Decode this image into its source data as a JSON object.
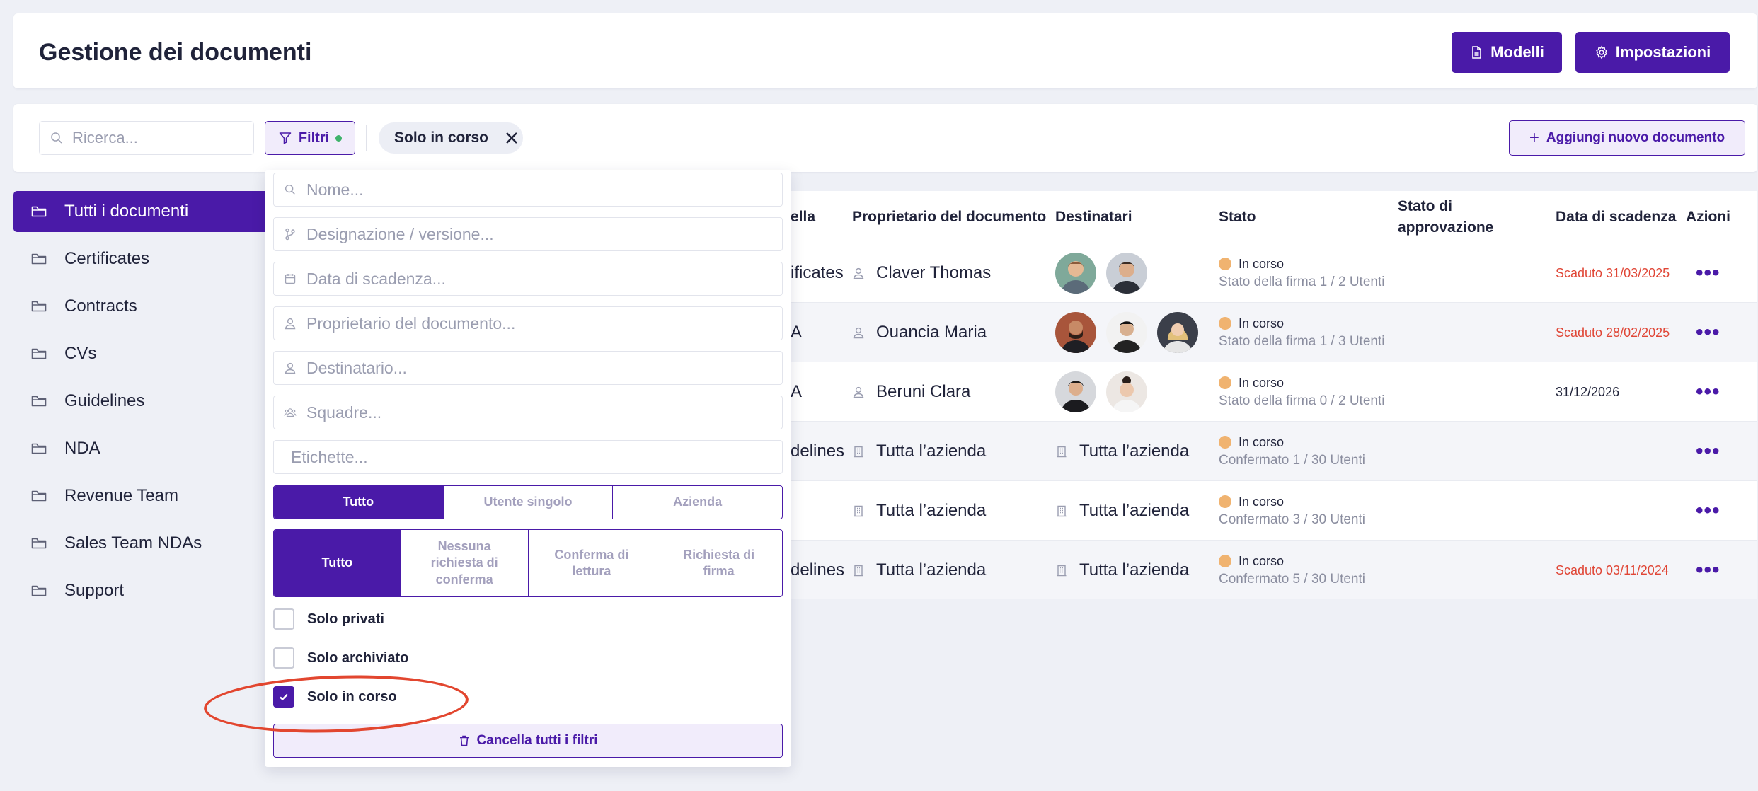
{
  "header": {
    "title": "Gestione dei documenti",
    "templates_label": "Modelli",
    "settings_label": "Impostazioni"
  },
  "toolbar": {
    "search_placeholder": "Ricerca...",
    "filter_label": "Filtri",
    "active_chip": "Solo in corso",
    "add_label": "Aggiungi nuovo documento"
  },
  "sidebar": {
    "items": [
      {
        "label": "Tutti i documenti",
        "active": true
      },
      {
        "label": "Certificates"
      },
      {
        "label": "Contracts"
      },
      {
        "label": "CVs"
      },
      {
        "label": "Guidelines"
      },
      {
        "label": "NDA"
      },
      {
        "label": "Revenue Team"
      },
      {
        "label": "Sales Team NDAs"
      },
      {
        "label": "Support"
      }
    ]
  },
  "table": {
    "columns": {
      "folder_partial": "ella",
      "owner": "Proprietario del documento",
      "recipients": "Destinatari",
      "status": "Stato",
      "approval_1": "Stato di",
      "approval_2": "approvazione",
      "due": "Data di scadenza",
      "actions": "Azioni"
    },
    "rows": [
      {
        "folder": "ificates",
        "owner": "Claver Thomas",
        "recipients_text": "",
        "status": "In corso",
        "status_sub": "Stato della firma 1 / 2 Utenti",
        "due": "Scaduto 31/03/2025",
        "due_red": true,
        "more": "•••"
      },
      {
        "folder": "A",
        "owner": "Ouancia Maria",
        "recipients_text": "",
        "status": "In corso",
        "status_sub": "Stato della firma 1 / 3 Utenti",
        "due": "Scaduto 28/02/2025",
        "due_red": true,
        "more": "•••"
      },
      {
        "folder": "A",
        "owner": "Beruni Clara",
        "recipients_text": "",
        "status": "In corso",
        "status_sub": "Stato della firma 0 / 2 Utenti",
        "due": "31/12/2026",
        "due_red": false,
        "more": "•••"
      },
      {
        "folder": "delines",
        "owner": "Tutta l’azienda",
        "recipients_text": "Tutta l’azienda",
        "status": "In corso",
        "status_sub": "Confermato 1 / 30 Utenti",
        "due": "",
        "due_red": false,
        "more": "•••"
      },
      {
        "folder": "",
        "owner": "Tutta l’azienda",
        "recipients_text": "Tutta l’azienda",
        "status": "In corso",
        "status_sub": "Confermato 3 / 30 Utenti",
        "due": "",
        "due_red": false,
        "more": "•••"
      },
      {
        "folder": "delines",
        "owner": "Tutta l’azienda",
        "recipients_text": "Tutta l’azienda",
        "status": "In corso",
        "status_sub": "Confermato 5 / 30 Utenti",
        "due": "Scaduto 03/11/2024",
        "due_red": true,
        "more": "•••"
      }
    ]
  },
  "filters": {
    "name_placeholder": "Nome...",
    "version_placeholder": "Designazione / versione...",
    "due_placeholder": "Data di scadenza...",
    "owner_placeholder": "Proprietario del documento...",
    "recipient_placeholder": "Destinatario...",
    "teams_placeholder": "Squadre...",
    "tags_placeholder": "Etichette...",
    "scope": {
      "all": "Tutto",
      "single": "Utente singolo",
      "company": "Azienda"
    },
    "type": {
      "all": "Tutto",
      "none_1": "Nessuna",
      "none_2": "richiesta di",
      "none_3": "conferma",
      "read_1": "Conferma di",
      "read_2": "lettura",
      "sign_1": "Richiesta di",
      "sign_2": "firma"
    },
    "only_private": "Solo privati",
    "only_archived": "Solo archiviato",
    "only_in_progress": "Solo in corso",
    "clear_all": "Cancella tutti i filtri"
  },
  "colors": {
    "accent": "#4a1aa8",
    "danger": "#e04636",
    "pending": "#f0b370",
    "highlight": "#e2462f"
  }
}
